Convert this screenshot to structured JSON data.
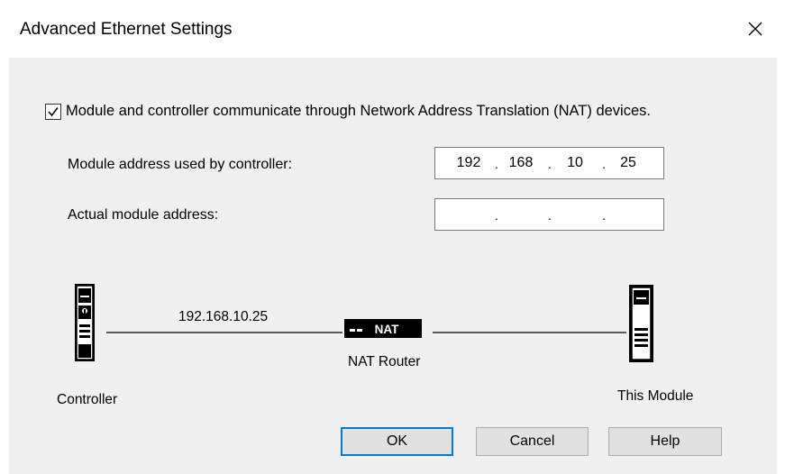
{
  "window": {
    "title": "Advanced Ethernet Settings",
    "close_icon": "close-icon"
  },
  "nat_checkbox": {
    "checked": true,
    "label": "Module and controller communicate through Network Address Translation (NAT) devices."
  },
  "fields": {
    "module_address_used": {
      "label": "Module address used by controller:",
      "octets": [
        "192",
        "168",
        "10",
        "25"
      ]
    },
    "actual_module_address": {
      "label": "Actual module address:",
      "octets": [
        "",
        "",
        "",
        ""
      ]
    }
  },
  "diagram": {
    "link_ip": "192.168.10.25",
    "router_badge": "NAT",
    "router_label": "NAT Router",
    "controller_label": "Controller",
    "module_label": "This Module",
    "icons": [
      "controller-icon",
      "nat-router-icon",
      "module-icon"
    ]
  },
  "buttons": {
    "ok": "OK",
    "cancel": "Cancel",
    "help": "Help"
  },
  "colors": {
    "focus_border": "#0078d7",
    "dialog_bg": "#f0f0f0"
  }
}
